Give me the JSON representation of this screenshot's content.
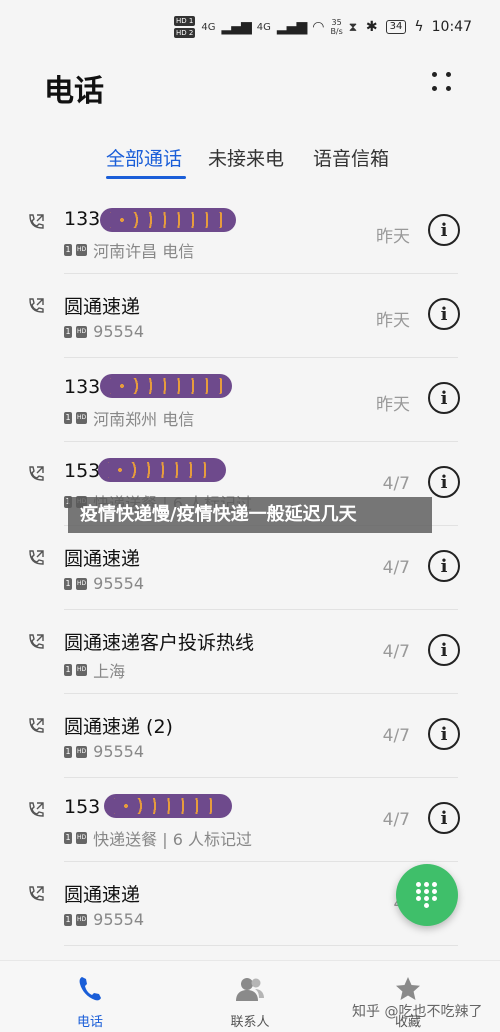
{
  "status_bar": {
    "hd_chip_1": "HD 1",
    "hd_chip_2": "HD 2",
    "signal_1": "4G",
    "signal_2": "4G",
    "speed_value": "35",
    "speed_unit": "B/s",
    "battery": "34",
    "time": "10:47"
  },
  "header": {
    "title": "电话"
  },
  "tabs": [
    {
      "label": "全部通话",
      "active": true
    },
    {
      "label": "未接来电",
      "active": false
    },
    {
      "label": "语音信箱",
      "active": false
    }
  ],
  "calls": [
    {
      "name": "133 8",
      "sub": "河南许昌 电信",
      "date": "昨天",
      "show_call_icon": true
    },
    {
      "name": "圆通速递",
      "sub": "95554",
      "date": "昨天",
      "show_call_icon": true
    },
    {
      "name": "133 0",
      "sub": "河南郑州 电信",
      "date": "昨天",
      "show_call_icon": false
    },
    {
      "name": "153",
      "sub": "快递送餐 | 6 人标记过",
      "date": "4/7",
      "show_call_icon": true
    },
    {
      "name": "圆通速递",
      "sub": "95554",
      "date": "4/7",
      "show_call_icon": true
    },
    {
      "name": "圆通速递客户投诉热线",
      "sub": "上海",
      "date": "4/7",
      "show_call_icon": true
    },
    {
      "name": "圆通速递 (2)",
      "sub": "95554",
      "date": "4/7",
      "show_call_icon": true
    },
    {
      "name": "153                    (2)",
      "sub": "快递送餐 | 6 人标记过",
      "date": "4/7",
      "show_call_icon": true
    },
    {
      "name": "圆通速递",
      "sub": "95554",
      "date": "4/",
      "show_call_icon": true
    }
  ],
  "banner": {
    "text": "疫情快递慢/疫情快递一般延迟几天"
  },
  "bottom_nav": [
    {
      "label": "电话",
      "icon": "phone-icon",
      "active": true
    },
    {
      "label": "联系人",
      "icon": "contacts-icon",
      "active": false
    },
    {
      "label": "收藏",
      "icon": "star-icon",
      "active": false
    }
  ],
  "watermark": "知乎 @吃也不吃辣了",
  "colors": {
    "accent": "#1a5ed8",
    "fab": "#3fbf6a"
  }
}
